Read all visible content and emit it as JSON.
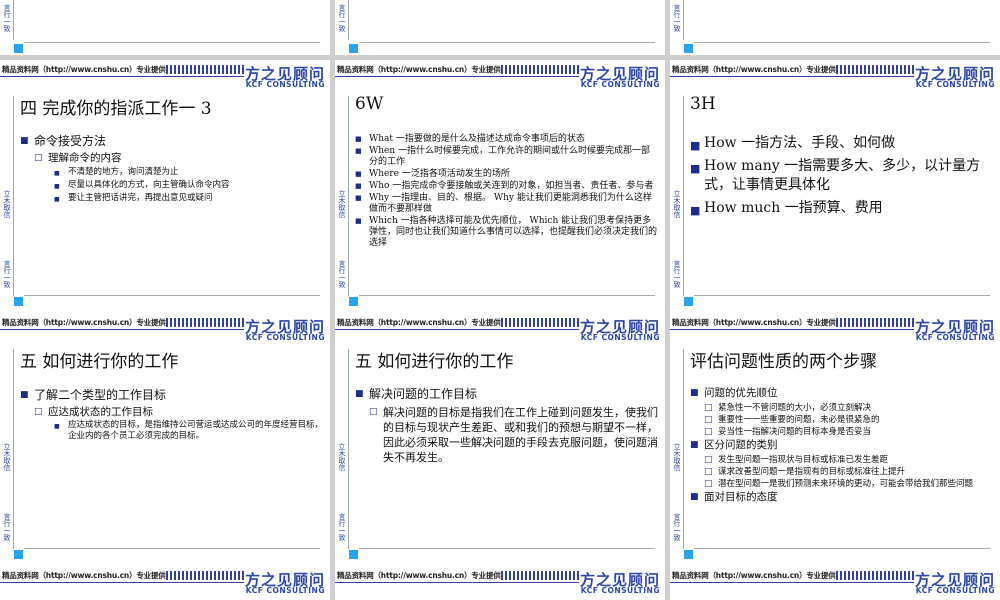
{
  "header": {
    "source": "精品资料网（http://www.cnshu.cn）专业提供企管培训资料",
    "brand_cn": "方之见顾问",
    "brand_en": "KCF CONSULTING"
  },
  "side": {
    "top": "立木取信",
    "bottom": "言行一致"
  },
  "slides": [
    {
      "title": "四  完成你的指派工作一 3",
      "items": [
        {
          "level": 1,
          "text": "命令接受方法"
        },
        {
          "level": 2,
          "text": "理解命令的内容"
        },
        {
          "level": 3,
          "text": "不清楚的地方，询问清楚为止"
        },
        {
          "level": 3,
          "text": "尽量以具体化的方式，向主管确认命令内容"
        },
        {
          "level": 3,
          "text": "要让主管把话讲完，再提出意见或疑问"
        }
      ]
    },
    {
      "title": "6W",
      "items": [
        {
          "level": 1,
          "text": "What 一指要做的是什么及描述达成命令事项后的状态"
        },
        {
          "level": 1,
          "text": "When 一指什么时候要完成，工作允许的期间或什么时候要完成那一部分的工作"
        },
        {
          "level": 1,
          "text": "Where 一泛指各项活动发生的场所"
        },
        {
          "level": 1,
          "text": "Who 一指完成命令要接触或关连到的对象，如担当者、责任者、参与者"
        },
        {
          "level": 1,
          "text": "Why 一指理由、目的、根据。 Why 能让我们更能洞悉我们为什么这样做而不要那样做"
        },
        {
          "level": 1,
          "text": "Which 一指各种选择可能及优先顺位， Which 能让我们思考保持更多弹性，同时也让我们知道什么事情可以选择，也提醒我们必须决定我们的选择"
        }
      ]
    },
    {
      "title": "3H",
      "items": [
        {
          "level": 1,
          "text": "How 一指方法、手段、如何做"
        },
        {
          "level": 1,
          "text": "How many 一指需要多大、多少，以计量方式，让事情更具体化"
        },
        {
          "level": 1,
          "text": "How much 一指预算、费用"
        }
      ]
    },
    {
      "title": "五  如何进行你的工作",
      "items": [
        {
          "level": 1,
          "text": "了解二个类型的工作目标"
        },
        {
          "level": 2,
          "text": "应达成状态的工作目标"
        },
        {
          "level": 3,
          "text": "应达成状态的目标，是指维持公司营运或达成公司的年度经营目标，企业内的各个员工必须完成的目标。"
        }
      ]
    },
    {
      "title": "五  如何进行你的工作",
      "items": [
        {
          "level": 1,
          "text": "解决问题的工作目标"
        },
        {
          "level": 2,
          "text": "解决问题的目标是指我们在工作上碰到问题发生，使我们的目标与现状产生差距、或和我们的预想与期望不一样，因此必须采取一些解决问题的手段去克服问题，使问题消失不再发生。"
        }
      ]
    },
    {
      "title": "评估问题性质的两个步骤",
      "items": [
        {
          "level": 1,
          "text": "问题的优先顺位"
        },
        {
          "level": 2,
          "text": "紧急性一不管问题的大小，必须立刻解决"
        },
        {
          "level": 2,
          "text": "重要性一一些重要的问题，未必是很紧急的"
        },
        {
          "level": 2,
          "text": "妥当性一指解决问题的目标本身是否妥当"
        },
        {
          "level": 1,
          "text": "区分问题的类别"
        },
        {
          "level": 2,
          "text": "发生型问题一指现状与目标或标准已发生差距"
        },
        {
          "level": 2,
          "text": "谋求改善型问题一是指现有的目标或标准往上提升"
        },
        {
          "level": 2,
          "text": "潜在型问题一是我们预测未来环境的更动，可能会带给我们那些问题"
        },
        {
          "level": 1,
          "text": "面对目标的态度"
        }
      ]
    }
  ]
}
